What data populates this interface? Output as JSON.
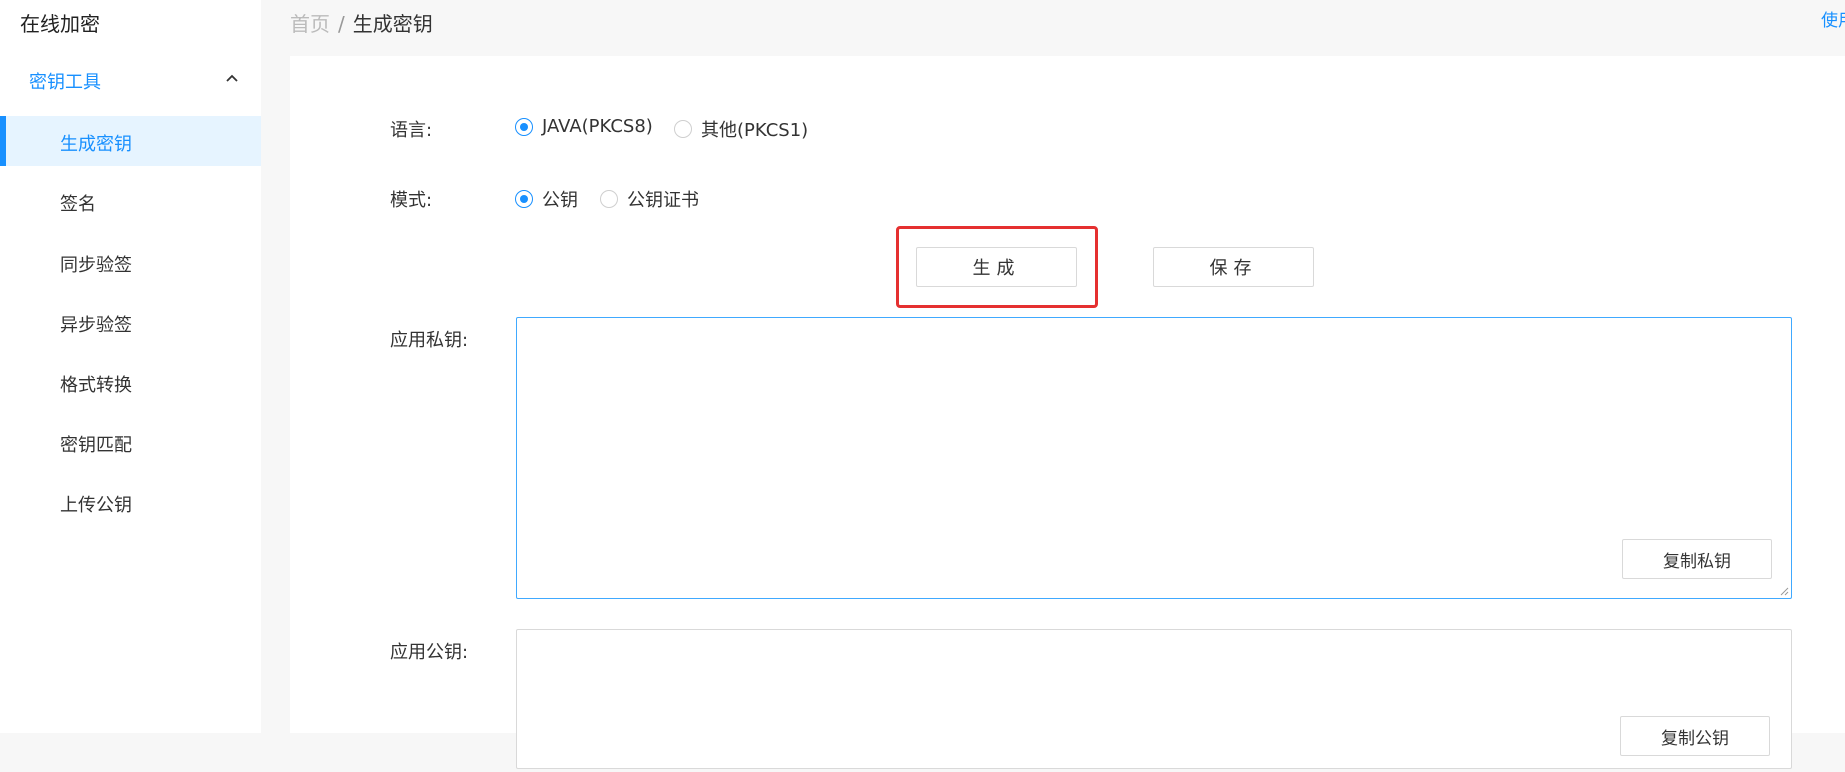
{
  "app": {
    "title": "在线加密"
  },
  "sidebar": {
    "group_label": "密钥工具",
    "items": [
      {
        "label": "生成密钥",
        "active": true
      },
      {
        "label": "签名"
      },
      {
        "label": "同步验签"
      },
      {
        "label": "异步验签"
      },
      {
        "label": "格式转换"
      },
      {
        "label": "密钥匹配"
      },
      {
        "label": "上传公钥"
      }
    ]
  },
  "header": {
    "breadcrumb_home": "首页",
    "breadcrumb_separator": "/",
    "breadcrumb_current": "生成密钥",
    "top_right_link": "使用"
  },
  "form": {
    "language_label": "语言:",
    "language_options": [
      "JAVA(PKCS8)",
      "其他(PKCS1)"
    ],
    "language_selected": "JAVA(PKCS8)",
    "mode_label": "模式:",
    "mode_options": [
      "公钥",
      "公钥证书"
    ],
    "mode_selected": "公钥",
    "generate_button": "生成",
    "save_button": "保存",
    "private_key_label": "应用私钥:",
    "private_key_value": "",
    "copy_private_button": "复制私钥",
    "public_key_label": "应用公钥:",
    "public_key_value": "",
    "copy_public_button": "复制公钥"
  },
  "colors": {
    "accent": "#1890ff",
    "highlight": "#e53030",
    "active_bg": "#e6f4ff"
  }
}
